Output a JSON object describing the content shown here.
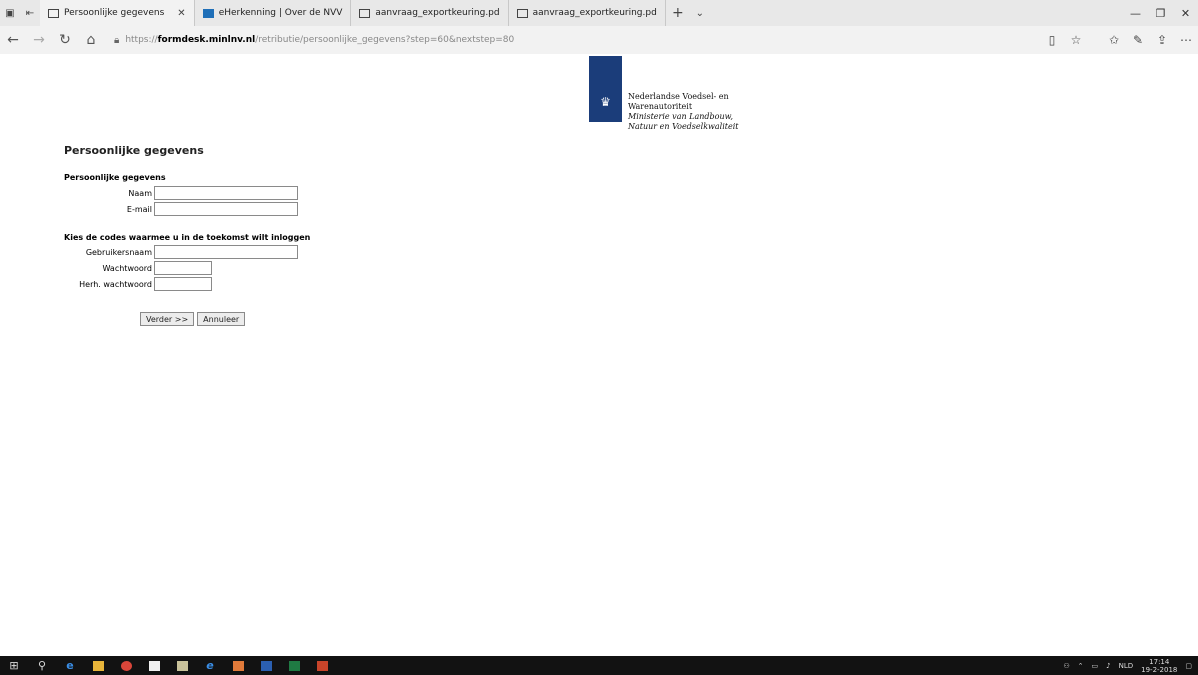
{
  "browser": {
    "tabs": [
      {
        "label": "Persoonlijke gegevens",
        "active": true
      },
      {
        "label": "eHerkenning | Over de NVV",
        "active": false
      },
      {
        "label": "aanvraag_exportkeuring.pd",
        "active": false
      },
      {
        "label": "aanvraag_exportkeuring.pd",
        "active": false
      }
    ],
    "url_prefix": "https://",
    "url_domain": "formdesk.minlnv.nl",
    "url_path": "/retributie/persoonlijke_gegevens?step=60&nextstep=80"
  },
  "logo": {
    "line1": "Nederlandse Voedsel- en",
    "line2": "Warenautoriteit",
    "line3": "Ministerie van Landbouw,",
    "line4": "Natuur en Voedselkwaliteit"
  },
  "form": {
    "page_title": "Persoonlijke gegevens",
    "section1_title": "Persoonlijke gegevens",
    "naam_label": "Naam",
    "naam_value": "",
    "email_label": "E-mail",
    "email_value": "",
    "section2_title": "Kies de codes waarmee u in de toekomst wilt inloggen",
    "gebruikersnaam_label": "Gebruikersnaam",
    "wachtwoord_label": "Wachtwoord",
    "herh_label": "Herh. wachtwoord",
    "verder_button": "Verder >>",
    "annuleer_button": "Annuleer"
  },
  "taskbar": {
    "lang": "NLD",
    "time": "17:14",
    "date": "19-2-2018"
  },
  "colors": {
    "logo_blue": "#1b3d7a",
    "taskbar_bg": "#121212"
  }
}
